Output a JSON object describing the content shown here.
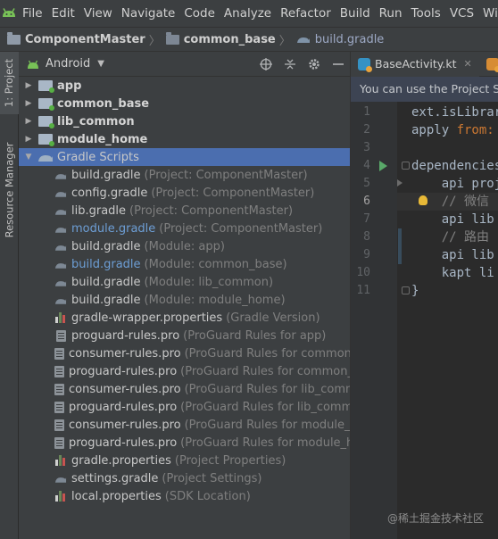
{
  "menubar": {
    "logo_icon": "android-studio-icon",
    "items": [
      "File",
      "Edit",
      "View",
      "Navigate",
      "Code",
      "Analyze",
      "Refactor",
      "Build",
      "Run",
      "Tools",
      "VCS",
      "Windo"
    ]
  },
  "breadcrumb": {
    "project": "ComponentMaster",
    "module": "common_base",
    "file": "build.gradle"
  },
  "left_strip": {
    "project_tab": "1: Project",
    "resource_tab": "Resource Manager"
  },
  "project_panel": {
    "view_mode": "Android",
    "tree": [
      {
        "name": "app",
        "kind": "module",
        "expanded": false
      },
      {
        "name": "common_base",
        "kind": "module",
        "expanded": false
      },
      {
        "name": "lib_common",
        "kind": "module",
        "expanded": false
      },
      {
        "name": "module_home",
        "kind": "module",
        "expanded": false
      },
      {
        "name": "Gradle Scripts",
        "kind": "group",
        "expanded": true,
        "selected": true
      },
      {
        "name": "build.gradle",
        "hint": "(Project: ComponentMaster)",
        "kind": "gradle"
      },
      {
        "name": "config.gradle",
        "hint": "(Project: ComponentMaster)",
        "kind": "gradle"
      },
      {
        "name": "lib.gradle",
        "hint": "(Project: ComponentMaster)",
        "kind": "gradle"
      },
      {
        "name": "module.gradle",
        "hint": "(Project: ComponentMaster)",
        "kind": "gradle",
        "modified": true
      },
      {
        "name": "build.gradle",
        "hint": "(Module: app)",
        "kind": "gradle"
      },
      {
        "name": "build.gradle",
        "hint": "(Module: common_base)",
        "kind": "gradle",
        "modified": true
      },
      {
        "name": "build.gradle",
        "hint": "(Module: lib_common)",
        "kind": "gradle"
      },
      {
        "name": "build.gradle",
        "hint": "(Module: module_home)",
        "kind": "gradle"
      },
      {
        "name": "gradle-wrapper.properties",
        "hint": "(Gradle Version)",
        "kind": "props"
      },
      {
        "name": "proguard-rules.pro",
        "hint": "(ProGuard Rules for app)",
        "kind": "doc"
      },
      {
        "name": "consumer-rules.pro",
        "hint": "(ProGuard Rules for common_bas",
        "kind": "doc"
      },
      {
        "name": "proguard-rules.pro",
        "hint": "(ProGuard Rules for common_bas",
        "kind": "doc"
      },
      {
        "name": "consumer-rules.pro",
        "hint": "(ProGuard Rules for lib_common)",
        "kind": "doc"
      },
      {
        "name": "proguard-rules.pro",
        "hint": "(ProGuard Rules for lib_common)",
        "kind": "doc"
      },
      {
        "name": "consumer-rules.pro",
        "hint": "(ProGuard Rules for module_hom",
        "kind": "doc"
      },
      {
        "name": "proguard-rules.pro",
        "hint": "(ProGuard Rules for module_hom",
        "kind": "doc"
      },
      {
        "name": "gradle.properties",
        "hint": "(Project Properties)",
        "kind": "props"
      },
      {
        "name": "settings.gradle",
        "hint": "(Project Settings)",
        "kind": "gradle"
      },
      {
        "name": "local.properties",
        "hint": "(SDK Location)",
        "kind": "props"
      }
    ]
  },
  "editor": {
    "tabs": [
      {
        "label": "BaseActivity.kt",
        "icon": "kotlin-file-icon"
      },
      {
        "label": "L",
        "icon": "layout-file-icon"
      }
    ],
    "notice": "You can use the Project Structure dialog",
    "lines": [
      {
        "n": "1",
        "text": "ext.isLibrary = true"
      },
      {
        "n": "2",
        "kw": "apply ",
        "kw2": "from:",
        "text": ""
      },
      {
        "n": "3",
        "text": ""
      },
      {
        "n": "4",
        "text": "dependencies {"
      },
      {
        "n": "5",
        "text": "    api project"
      },
      {
        "n": "6",
        "comment": "    // 微信",
        "current": true
      },
      {
        "n": "7",
        "text": "    api lib"
      },
      {
        "n": "8",
        "comment": "    // 路由"
      },
      {
        "n": "9",
        "text": "    api lib"
      },
      {
        "n": "10",
        "text": "    kapt li"
      },
      {
        "n": "11",
        "text": "}"
      }
    ]
  },
  "watermark": "@稀土掘金技术社区"
}
